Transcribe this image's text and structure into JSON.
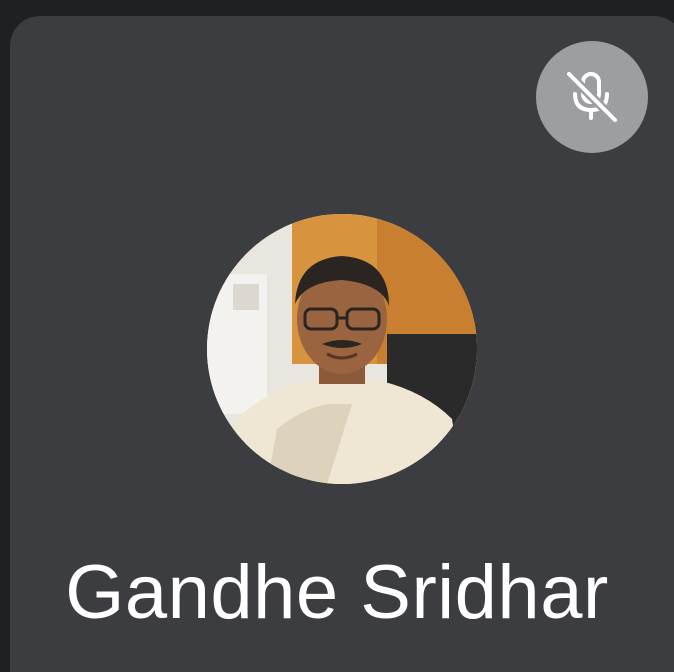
{
  "participant": {
    "name": "Gandhe Sridhar",
    "avatar_icon": "profile-photo",
    "mic_status_icon": "mic-off-icon"
  },
  "colors": {
    "background": "#1f2023",
    "tile": "#3c3d41",
    "mute_badge": "#9d9ea1",
    "name_text": "#ffffff"
  }
}
